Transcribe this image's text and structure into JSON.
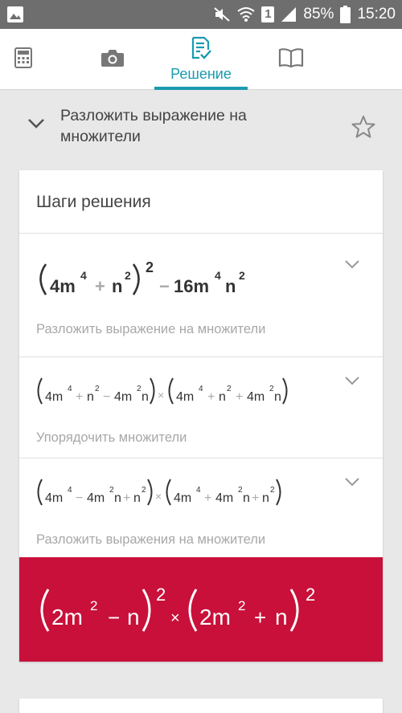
{
  "status_bar": {
    "battery": "85%",
    "time": "15:20",
    "sim_label": "1",
    "icons": [
      "gallery-icon",
      "mute-icon",
      "wifi-icon",
      "sim-icon",
      "signal-icon",
      "battery-icon"
    ]
  },
  "tabs": [
    {
      "icon": "calculator-icon",
      "label": ""
    },
    {
      "icon": "camera-icon",
      "label": ""
    },
    {
      "icon": "solution-icon",
      "label": "Решение"
    },
    {
      "icon": "book-icon",
      "label": ""
    }
  ],
  "problem": {
    "title": "Разложить выражение на множители"
  },
  "card": {
    "title": "Шаги решения"
  },
  "steps": [
    {
      "description": "Разложить выражение на множители",
      "formula": {
        "a": "4m",
        "e1": "4",
        "p": "+",
        "b": "n",
        "e2": "2",
        "outer": "2",
        "m": "−",
        "c": "16m",
        "e3": "4",
        "d": "n",
        "e4": "2"
      }
    },
    {
      "description": "Упорядочить множители",
      "formula": {
        "t1": "4m",
        "t2": "n",
        "t3": "4m",
        "t4": "n",
        "x": "×",
        "t5": "4m",
        "t6": "n",
        "t7": "4m",
        "t8": "n"
      }
    },
    {
      "description": "Разложить выражения на множители",
      "formula": {
        "t1": "4m",
        "t2": "4m",
        "t3": "n",
        "t4": "n",
        "x": "×",
        "t5": "4m",
        "t6": "4m",
        "t7": "n",
        "t8": "n"
      }
    }
  ],
  "result": {
    "formula": {
      "a": "2m",
      "e1": "2",
      "m": "−",
      "n1": "n",
      "o1": "2",
      "x": "×",
      "b": "2m",
      "e2": "2",
      "p": "+",
      "n2": "n",
      "o2": "2"
    }
  },
  "colors": {
    "accent": "#1a9ab0",
    "result_bg": "#c8103a",
    "status_bg": "#6e6e6e"
  }
}
